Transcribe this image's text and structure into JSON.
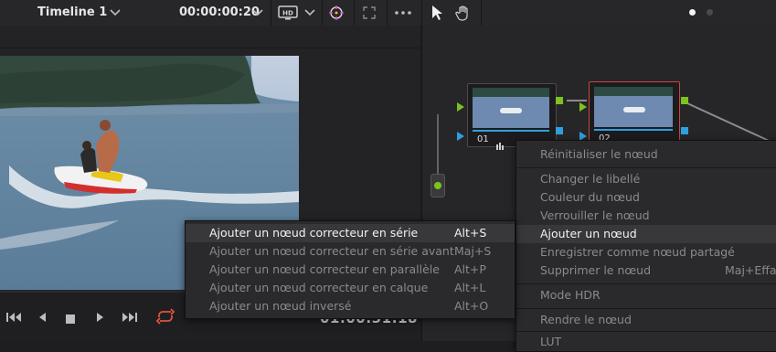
{
  "toolbar": {
    "timeline_name": "Timeline 1",
    "timecode": "00:00:00:20"
  },
  "viewer": {
    "playhead_timecode": "01:00:31:18"
  },
  "nodes": [
    {
      "number": "01"
    },
    {
      "number": "02"
    }
  ],
  "add_node_submenu": {
    "items": [
      {
        "label": "Ajouter un nœud correcteur en série",
        "shortcut": "Alt+S",
        "enabled": true,
        "highlighted": true
      },
      {
        "label": "Ajouter un nœud correcteur en série avant",
        "shortcut": "Maj+S",
        "enabled": false
      },
      {
        "label": "Ajouter un nœud correcteur en parallèle",
        "shortcut": "Alt+P",
        "enabled": false
      },
      {
        "label": "Ajouter un nœud correcteur en calque",
        "shortcut": "Alt+L",
        "enabled": false
      },
      {
        "label": "Ajouter un nœud inversé",
        "shortcut": "Alt+O",
        "enabled": false
      }
    ]
  },
  "node_context_menu": {
    "items": [
      {
        "label": "Réinitialiser le nœud",
        "shortcut": "",
        "enabled": false
      },
      {
        "label": "Changer le libellé",
        "shortcut": "",
        "enabled": false
      },
      {
        "label": "Couleur du nœud",
        "shortcut": "",
        "enabled": false
      },
      {
        "label": "Verrouiller le nœud",
        "shortcut": "",
        "enabled": false
      },
      {
        "label": "Ajouter un nœud",
        "shortcut": "",
        "enabled": true,
        "highlighted": true
      },
      {
        "label": "Enregistrer comme nœud partagé",
        "shortcut": "",
        "enabled": false
      },
      {
        "label": "Supprimer le nœud",
        "shortcut": "Maj+Effac",
        "enabled": false
      },
      {
        "label": "Mode HDR",
        "shortcut": "",
        "enabled": false
      },
      {
        "label": "Rendre le nœud",
        "shortcut": "",
        "enabled": false
      },
      {
        "label": "LUT",
        "shortcut": "",
        "enabled": false
      }
    ]
  },
  "colors": {
    "accent_red": "#e0533a",
    "node_input_green": "#7cc31f",
    "node_output_blue": "#2f9fe0",
    "selected_node_border": "#c9473a"
  },
  "icons": [
    "chevron-down-icon",
    "chevron-down-icon",
    "hd-monitor-icon",
    "color-picker-icon",
    "fullscreen-icon",
    "more-icon",
    "pointer-icon",
    "hand-icon",
    "skip-back-icon",
    "play-reverse-icon",
    "stop-icon",
    "play-icon",
    "skip-forward-icon",
    "loop-icon"
  ]
}
